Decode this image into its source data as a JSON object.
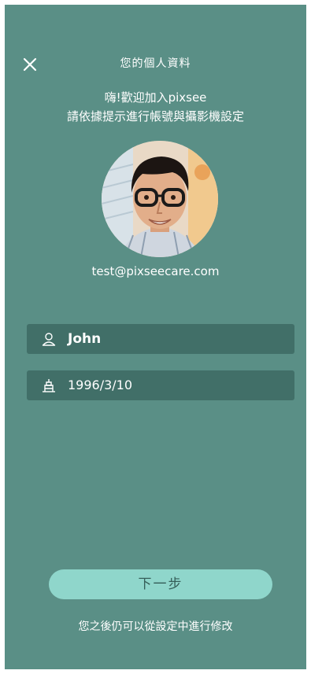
{
  "header": {
    "title": "您的個人資料",
    "close_icon": "close-icon"
  },
  "welcome": {
    "line1": "嗨!歡迎加入pixsee",
    "line2": "請依據提示進行帳號與攝影機設定"
  },
  "profile": {
    "avatar_icon": "user-photo",
    "email": "test@pixseecare.com"
  },
  "fields": {
    "name": {
      "icon": "person-icon",
      "value": "John"
    },
    "birthday": {
      "icon": "birthday-cake-icon",
      "value": "1996/3/10"
    }
  },
  "footer": {
    "next_label": "下一步",
    "note": "您之後仍可以從設定中進行修改"
  },
  "colors": {
    "background": "#5a8f86",
    "field_bg": "#416f68",
    "button_bg": "#8fd6cb",
    "button_text": "#355e58",
    "text": "#ffffff"
  }
}
